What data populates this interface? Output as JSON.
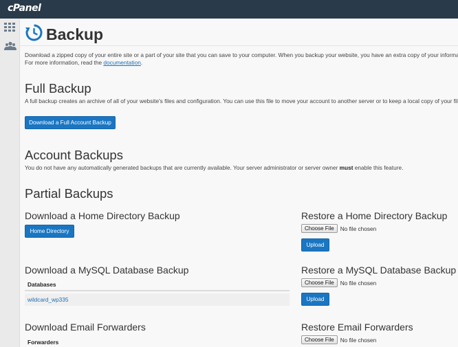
{
  "header": {
    "logo_text": "cPanel"
  },
  "sidebar": {
    "items": [
      {
        "name": "tools",
        "icon": "grid-icon"
      },
      {
        "name": "users",
        "icon": "users-icon"
      }
    ]
  },
  "page": {
    "title": "Backup",
    "intro_line1": "Download a zipped copy of your entire site or a part of your site that you can save to your computer. When you backup your website, you have an extra copy of your informatio",
    "intro_line2_prefix": "For more information, read the ",
    "intro_link": "documentation",
    "intro_line2_suffix": "."
  },
  "full_backup": {
    "heading": "Full Backup",
    "description": "A full backup creates an archive of all of your website's files and configuration. You can use this file to move your account to another server or to keep a local copy of your files.",
    "button": "Download a Full Account Backup"
  },
  "account_backups": {
    "heading": "Account Backups",
    "desc_before": "You do not have any automatically generated backups that are currently available. Your server administrator or server owner ",
    "desc_bold": "must",
    "desc_after": " enable this feature."
  },
  "partial_backups": {
    "heading": "Partial Backups",
    "home_download_heading": "Download a Home Directory Backup",
    "home_button": "Home Directory",
    "home_restore_heading": "Restore a Home Directory Backup",
    "mysql_download_heading": "Download a MySQL Database Backup",
    "databases_header": "Databases",
    "databases": [
      "wildcard_wp335"
    ],
    "mysql_restore_heading": "Restore a MySQL Database Backup",
    "email_download_heading": "Download Email Forwarders",
    "forwarders_header": "Forwarders",
    "email_restore_heading": "Restore Email Forwarders",
    "choose_file_label": "Choose File",
    "no_file_text": "No file chosen",
    "upload_label": "Upload"
  },
  "colors": {
    "topbar": "#293a4a",
    "primary_button": "#1a76c2",
    "link": "#1a6fb6",
    "icon_blue": "#1a76c2"
  }
}
